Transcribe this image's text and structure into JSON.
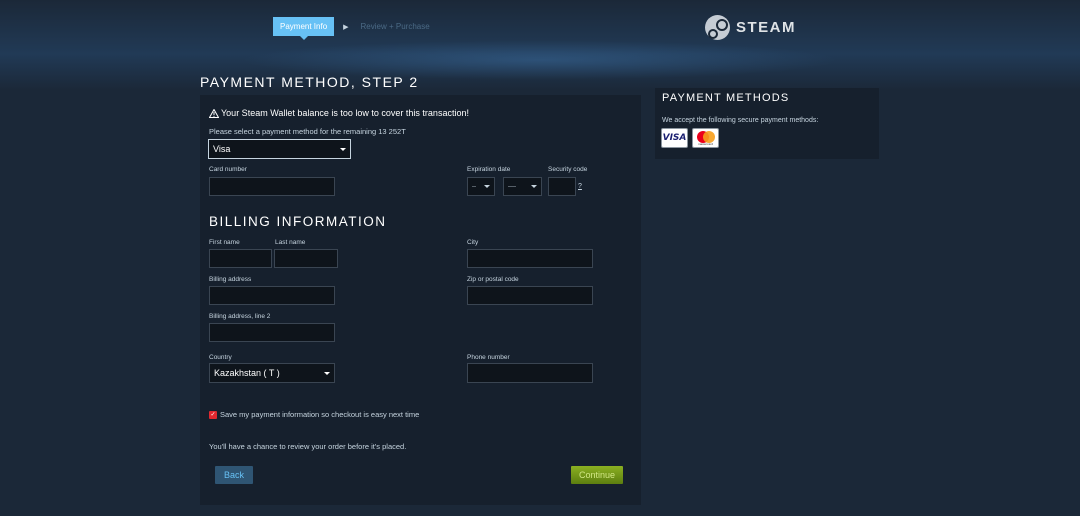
{
  "header": {
    "steps": [
      {
        "label": "Payment Info",
        "active": true
      },
      {
        "label": "Review + Purchase",
        "active": false
      }
    ],
    "logo_text": "STEAM",
    "step_arrow_icon": "chevron-right-icon"
  },
  "page": {
    "title": "PAYMENT METHOD, STEP 2"
  },
  "payment": {
    "warning_icon": "warning-icon",
    "warning": "Your Steam Wallet balance is too low to cover this transaction!",
    "select_prompt": "Please select a payment method for the remaining 13 252T",
    "method_value": "Visa",
    "card_number_label": "Card number",
    "expiration_label": "Expiration date",
    "exp_month_value": "--",
    "exp_year_value": "----",
    "security_code_label": "Security code",
    "security_help": "?"
  },
  "billing": {
    "title": "BILLING INFORMATION",
    "first_name_label": "First name",
    "last_name_label": "Last name",
    "city_label": "City",
    "address_label": "Billing address",
    "zip_label": "Zip or postal code",
    "address2_label": "Billing address, line 2",
    "country_label": "Country",
    "country_value": "Kazakhstan ( T )",
    "phone_label": "Phone number"
  },
  "footer": {
    "save_info_label": "Save my payment information so checkout is easy next time",
    "save_info_checked": true,
    "review_note": "You'll have a chance to review your order before it's placed.",
    "back_label": "Back",
    "continue_label": "Continue"
  },
  "side": {
    "title": "PAYMENT METHODS",
    "text": "We accept the following secure payment methods:",
    "cards": [
      {
        "name": "VISA",
        "icon": "visa-card-icon"
      },
      {
        "name": "mastercard",
        "icon": "mastercard-icon"
      }
    ]
  },
  "colors": {
    "background": "#1b2838",
    "panel": "#16202d",
    "accent_blue": "#67c1f5",
    "continue_green": "#75a11a"
  }
}
